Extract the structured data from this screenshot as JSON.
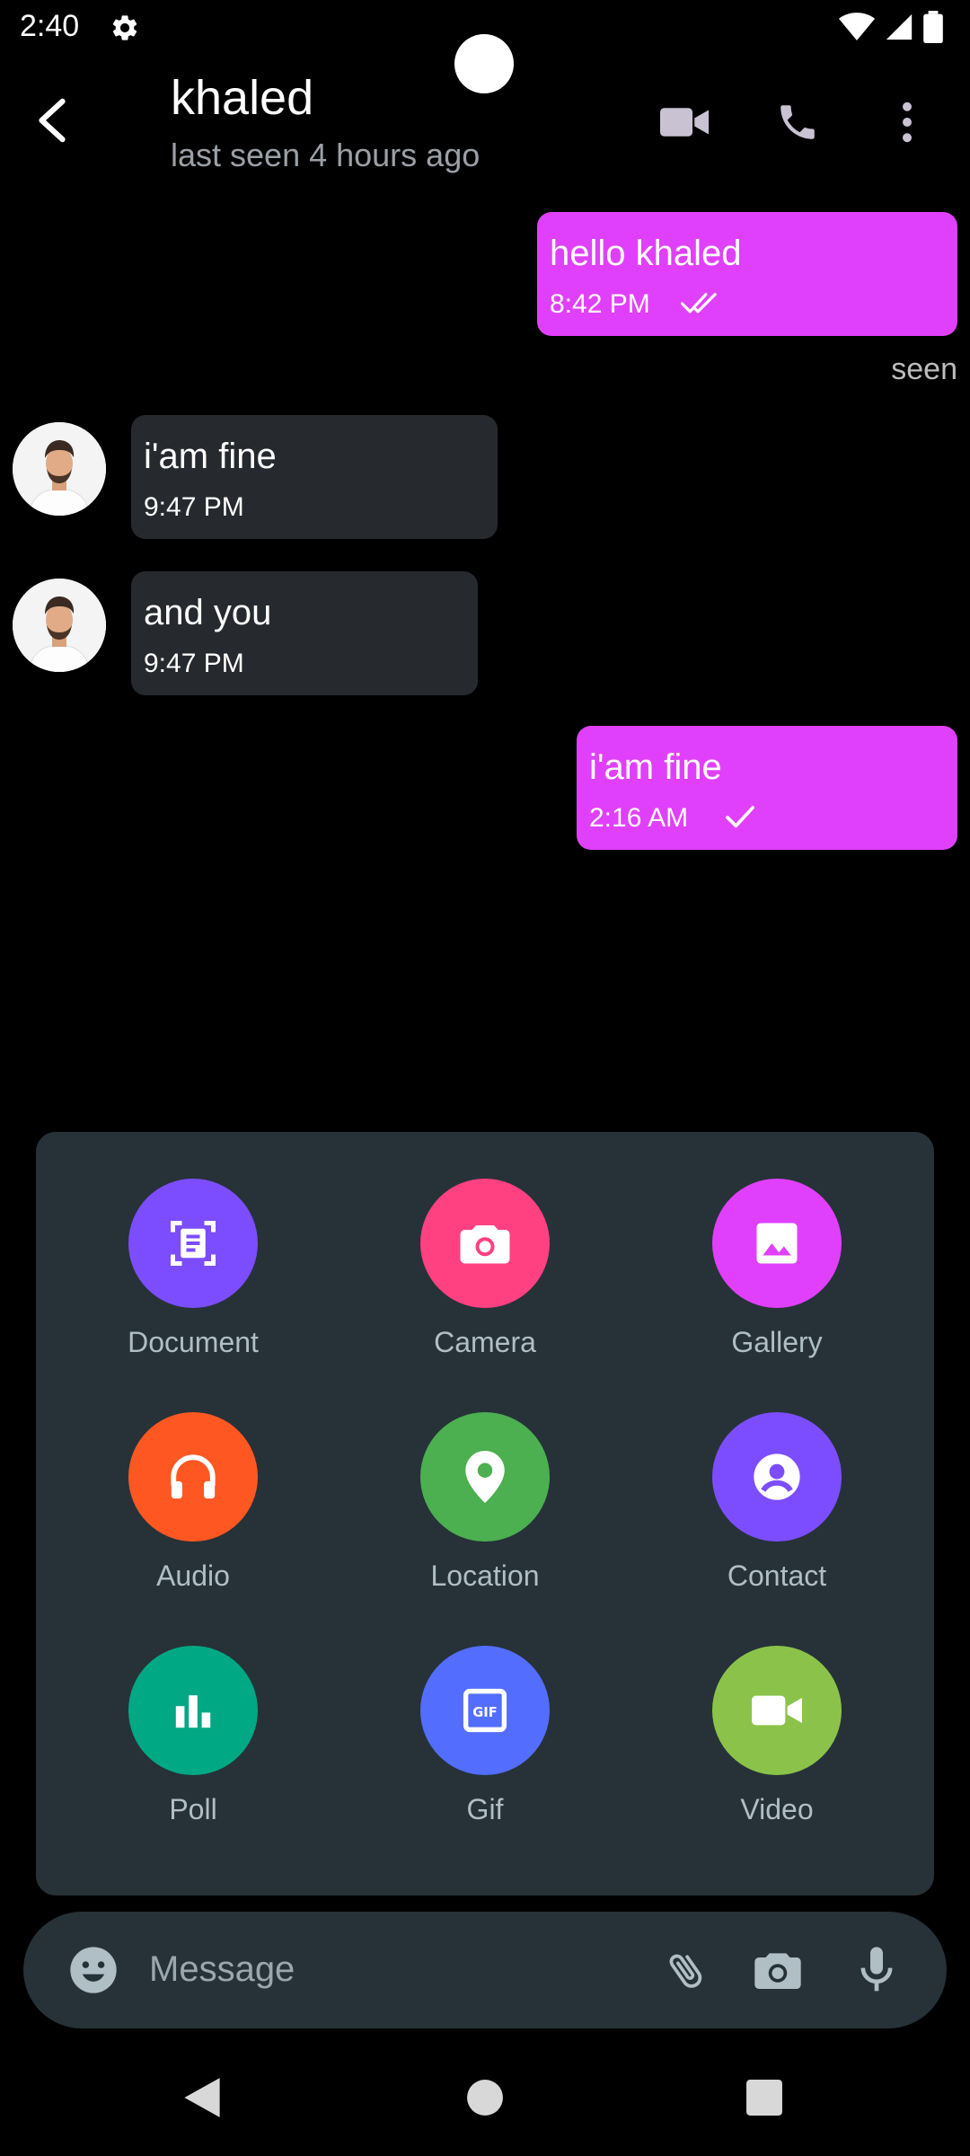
{
  "status_bar": {
    "time": "2:40"
  },
  "header": {
    "name": "khaled",
    "status": "last seen 4 hours ago"
  },
  "messages": [
    {
      "direction": "out",
      "text": "hello khaled",
      "time": "8:42 PM",
      "receipt": "double-check"
    },
    {
      "direction": "in",
      "text": "i'am fine",
      "time": "9:47 PM"
    },
    {
      "direction": "in",
      "text": "and you",
      "time": "9:47 PM"
    },
    {
      "direction": "out",
      "text": "i'am fine",
      "time": "2:16 AM",
      "receipt": "single-check"
    }
  ],
  "seen_label": "seen",
  "attachments": [
    {
      "label": "Document",
      "icon": "document-icon",
      "color": "#7c4dff"
    },
    {
      "label": "Camera",
      "icon": "camera-icon",
      "color": "#ff4081"
    },
    {
      "label": "Gallery",
      "icon": "gallery-icon",
      "color": "#e040fb"
    },
    {
      "label": "Audio",
      "icon": "headphones-icon",
      "color": "#ff5722"
    },
    {
      "label": "Location",
      "icon": "location-pin-icon",
      "color": "#4caf50"
    },
    {
      "label": "Contact",
      "icon": "contact-icon",
      "color": "#7c4dff"
    },
    {
      "label": "Poll",
      "icon": "poll-icon",
      "color": "#00a884"
    },
    {
      "label": "Gif",
      "icon": "gif-icon",
      "color": "#536dfe"
    },
    {
      "label": "Video",
      "icon": "video-icon",
      "color": "#8bc34a"
    }
  ],
  "input": {
    "placeholder": "Message"
  },
  "colors": {
    "outgoing_bubble": "#e040fb",
    "incoming_bubble": "#26292d",
    "panel": "#263238"
  }
}
